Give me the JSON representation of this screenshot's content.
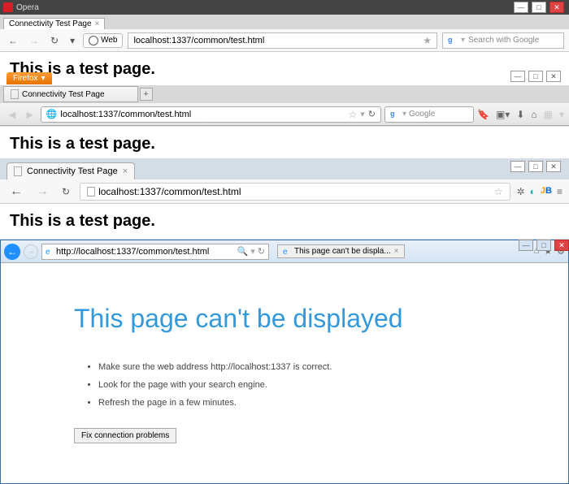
{
  "opera": {
    "app": "Opera",
    "tab": "Connectivity Test Page",
    "web_label": "Web",
    "url": "localhost:1337/common/test.html",
    "search_ph": "Search with Google",
    "heading": "This is a test page."
  },
  "firefox": {
    "btn": "Firefox",
    "tab": "Connectivity Test Page",
    "url": "localhost:1337/common/test.html",
    "search_ph": "Google",
    "heading": "This is a test page."
  },
  "chrome": {
    "tab": "Connectivity Test Page",
    "url": "localhost:1337/common/test.html",
    "heading": "This is a test page."
  },
  "ie": {
    "url": "http://localhost:1337/common/test.html",
    "tab": "This page can't be displa...",
    "heading": "This page can't be displayed",
    "bullets": [
      "Make sure the web address http://localhost:1337 is correct.",
      "Look for the page with your search engine.",
      "Refresh the page in a few minutes."
    ],
    "fix_btn": "Fix connection problems"
  }
}
